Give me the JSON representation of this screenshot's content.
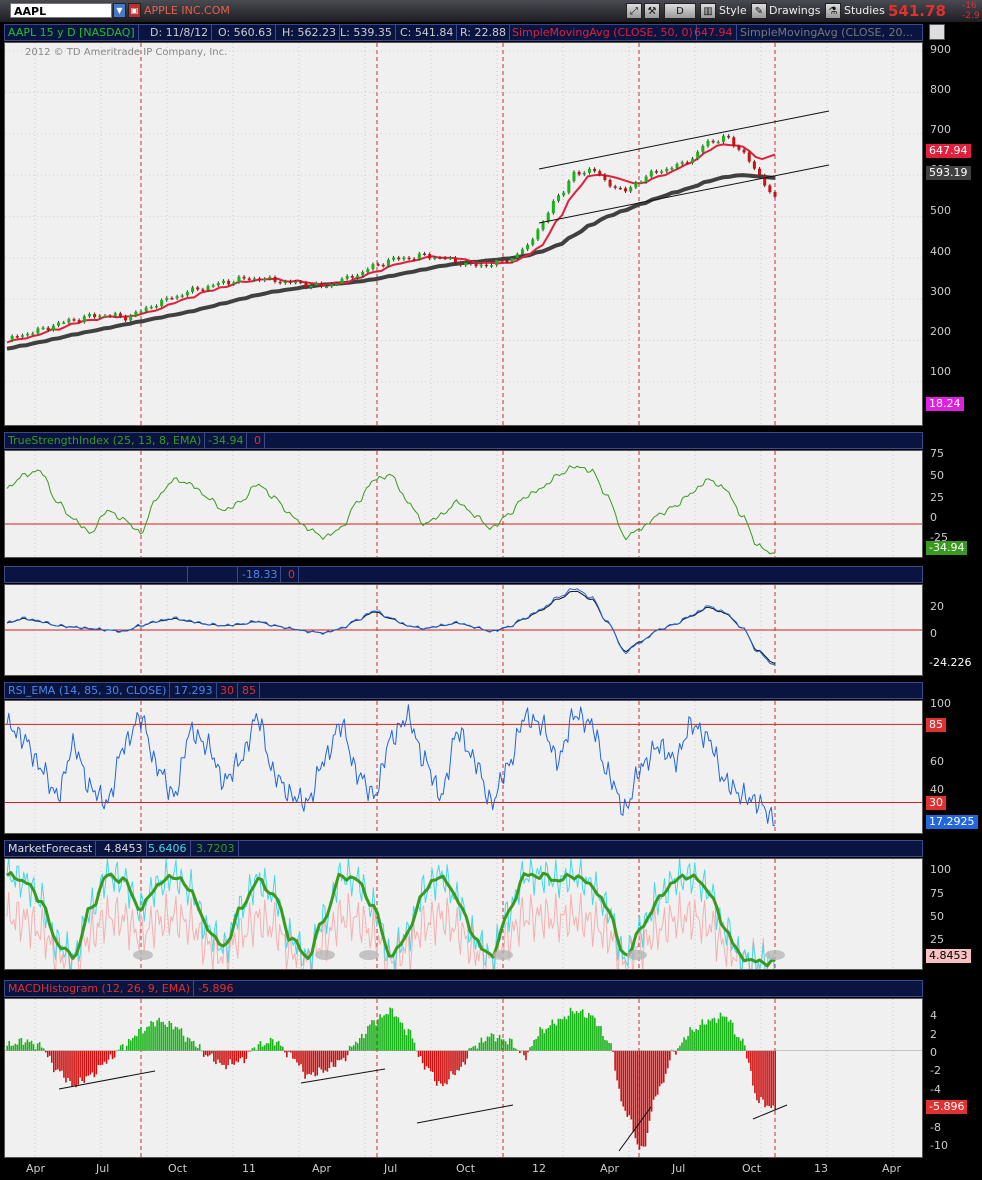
{
  "toolbar": {
    "symbol": "AAPL",
    "company": "APPLE INC.COM",
    "period_button": "D",
    "style_label": "Style",
    "drawings_label": "Drawings",
    "studies_label": "Studies",
    "last_price": "541.78",
    "change_1": "-16",
    "change_2": "-2.9"
  },
  "colors": {
    "up": "#19b319",
    "down": "#cc1010",
    "sma50": "#e0203c",
    "sma200": "#404040",
    "tsi": "#3a9a20",
    "blue": "#2266dd",
    "grid": "#c83030"
  },
  "price_header": {
    "title": "AAPL 15 y D [NASDAQ]",
    "date": "D: 11/8/12",
    "open": "O: 560.63",
    "high": "H: 562.23",
    "low": "L: 539.35",
    "close": "C: 541.84",
    "range": "R: 22.88",
    "sma50_label": "SimpleMovingAvg (CLOSE, 50, 0)",
    "sma50_value": "647.94",
    "sma200_label": "SimpleMovingAvg (CLOSE, 20..."
  },
  "watermark": "2012 © TD Ameritrade IP Company, Inc.",
  "price_axis": {
    "ticks": [
      "900",
      "800",
      "700",
      "600",
      "500",
      "400",
      "300",
      "200",
      "100"
    ],
    "badge_sma50": "647.94",
    "badge_sma200": "593.19",
    "badge_bottom": "18.24"
  },
  "tsi_header": {
    "label": "TrueStrengthIndex (25, 13, 8, EMA)",
    "value": "-34.94",
    "zero": "0"
  },
  "tsi_axis": {
    "ticks": [
      "75",
      "50",
      "25",
      "0",
      "-25"
    ],
    "badge": "-34.94"
  },
  "osc_header": {
    "value": "-18.33",
    "zero": "0"
  },
  "osc_axis": {
    "ticks": [
      "20",
      "0"
    ],
    "badge": "-24.226"
  },
  "rsi_header": {
    "label": "RSI_EMA (14, 85, 30, CLOSE)",
    "value": "17.293",
    "lo": "30",
    "hi": "85"
  },
  "rsi_axis": {
    "ticks": [
      "100",
      "60",
      "40"
    ],
    "badge_hi": "85",
    "badge_lo": "30",
    "badge": "17.2925"
  },
  "mf_header": {
    "label": "MarketForecast",
    "v1": "4.8453",
    "v2": "5.6406",
    "v3": "3.7203"
  },
  "mf_axis": {
    "ticks": [
      "100",
      "75",
      "50",
      "25"
    ],
    "badge": "4.8453"
  },
  "macd_header": {
    "label": "MACDHistogram (12, 26, 9, EMA)",
    "value": "-5.896"
  },
  "macd_axis": {
    "ticks": [
      "4",
      "2",
      "0",
      "-2",
      "-4",
      "-6",
      "-8",
      "-10"
    ],
    "badge": "-5.896"
  },
  "x_axis": {
    "labels": [
      "Apr",
      "Jul",
      "Oct",
      "11",
      "Apr",
      "Jul",
      "Oct",
      "12",
      "Apr",
      "Jul",
      "Oct",
      "13",
      "Apr"
    ]
  },
  "chart_data": {
    "type": "line",
    "title": "AAPL 15 y D [NASDAQ]",
    "x_labels": [
      "Apr",
      "Jul",
      "Oct",
      "11",
      "Apr",
      "Jul",
      "Oct",
      "12",
      "Apr",
      "Jul",
      "Oct",
      "13",
      "Apr"
    ],
    "price": {
      "ylim": [
        0,
        900
      ],
      "close": [
        200,
        215,
        225,
        240,
        250,
        258,
        262,
        255,
        270,
        290,
        305,
        320,
        330,
        340,
        348,
        350,
        345,
        340,
        335,
        330,
        345,
        360,
        380,
        395,
        400,
        405,
        400,
        390,
        380,
        385,
        395,
        420,
        480,
        550,
        600,
        615,
        580,
        560,
        590,
        610,
        620,
        640,
        680,
        690,
        660,
        600,
        545
      ],
      "sma50": [
        195,
        205,
        215,
        228,
        240,
        250,
        256,
        258,
        262,
        275,
        290,
        305,
        318,
        330,
        340,
        347,
        348,
        344,
        340,
        335,
        338,
        350,
        365,
        380,
        390,
        400,
        402,
        398,
        390,
        386,
        388,
        400,
        430,
        490,
        560,
        600,
        600,
        585,
        580,
        595,
        612,
        630,
        660,
        675,
        670,
        640,
        648
      ],
      "sma200": [
        180,
        188,
        196,
        205,
        214,
        222,
        230,
        238,
        246,
        254,
        262,
        270,
        280,
        290,
        300,
        310,
        318,
        324,
        330,
        335,
        338,
        342,
        348,
        356,
        364,
        372,
        380,
        386,
        390,
        394,
        398,
        404,
        415,
        430,
        455,
        480,
        500,
        515,
        530,
        545,
        558,
        570,
        585,
        595,
        600,
        597,
        593
      ]
    },
    "tsi": {
      "ylim": [
        -35,
        80
      ],
      "values": [
        40,
        55,
        60,
        25,
        5,
        -10,
        15,
        5,
        -10,
        30,
        50,
        45,
        30,
        15,
        25,
        45,
        30,
        10,
        -5,
        -15,
        -5,
        25,
        50,
        55,
        25,
        0,
        10,
        25,
        10,
        -5,
        10,
        30,
        40,
        55,
        65,
        60,
        30,
        -15,
        -5,
        10,
        20,
        35,
        50,
        40,
        10,
        -25,
        -34.94
      ]
    },
    "osc": {
      "ylim": [
        -30,
        30
      ],
      "values": [
        5,
        8,
        6,
        3,
        2,
        1,
        0,
        -1,
        3,
        6,
        8,
        6,
        4,
        3,
        4,
        6,
        3,
        1,
        -1,
        -2,
        1,
        7,
        13,
        8,
        3,
        1,
        3,
        5,
        2,
        -1,
        2,
        8,
        14,
        22,
        28,
        22,
        5,
        -15,
        -8,
        0,
        4,
        10,
        16,
        12,
        2,
        -15,
        -24.226
      ]
    },
    "rsi": {
      "ylim": [
        10,
        100
      ],
      "hi": 85,
      "lo": 30,
      "values": [
        85,
        75,
        55,
        35,
        70,
        40,
        30,
        70,
        90,
        55,
        35,
        80,
        70,
        45,
        60,
        90,
        50,
        35,
        30,
        60,
        85,
        50,
        35,
        75,
        90,
        60,
        35,
        80,
        60,
        30,
        55,
        90,
        85,
        60,
        92,
        85,
        50,
        25,
        55,
        70,
        60,
        85,
        75,
        45,
        35,
        30,
        17.2925
      ]
    },
    "market_forecast": {
      "ylim": [
        0,
        110
      ],
      "values": [
        95,
        90,
        70,
        25,
        10,
        60,
        95,
        90,
        60,
        85,
        95,
        80,
        40,
        20,
        60,
        90,
        75,
        30,
        10,
        50,
        95,
        90,
        60,
        10,
        35,
        80,
        95,
        70,
        30,
        10,
        55,
        95,
        95,
        90,
        95,
        85,
        60,
        10,
        40,
        70,
        90,
        95,
        80,
        40,
        10,
        5,
        4.8453
      ]
    },
    "macd_hist": {
      "ylim": [
        -10.5,
        5
      ],
      "values": [
        0.5,
        1,
        0.5,
        -2,
        -3.5,
        -2.5,
        -1,
        0.5,
        2,
        3,
        2.5,
        1,
        -0.5,
        -1.5,
        -1,
        0.5,
        1,
        -0.5,
        -2.5,
        -2,
        -1,
        1,
        3,
        4,
        2,
        -1.5,
        -3.5,
        -2,
        0.5,
        1.5,
        1,
        -0.5,
        2,
        3,
        4,
        3.5,
        1,
        -6,
        -10,
        -4,
        0,
        2,
        3,
        3.5,
        1,
        -5,
        -5.896
      ]
    }
  }
}
